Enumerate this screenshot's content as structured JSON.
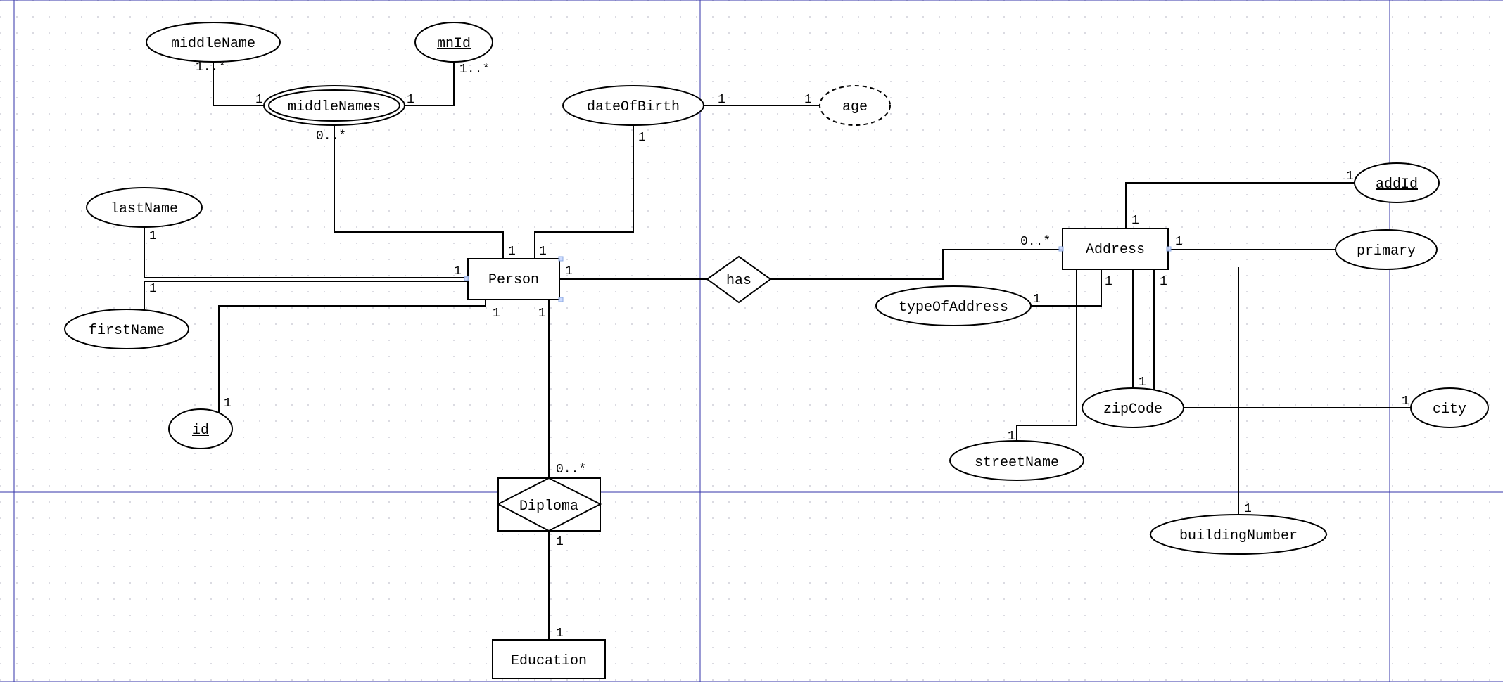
{
  "entities": {
    "person": "Person",
    "address": "Address",
    "education": "Education"
  },
  "relationships": {
    "has": "has",
    "diploma": "Diploma"
  },
  "attributes": {
    "middleName": "middleName",
    "mnId": "mnId",
    "middleNames": "middleNames",
    "dateOfBirth": "dateOfBirth",
    "age": "age",
    "lastName": "lastName",
    "firstName": "firstName",
    "id": "id",
    "addId": "addId",
    "primary": "primary",
    "typeOfAddress": "typeOfAddress",
    "zipCode": "zipCode",
    "streetName": "streetName",
    "buildingNumber": "buildingNumber",
    "city": "city"
  },
  "cardinalities": {
    "c1": "1",
    "zeroStar": "0..*",
    "oneStar": "1..*"
  }
}
